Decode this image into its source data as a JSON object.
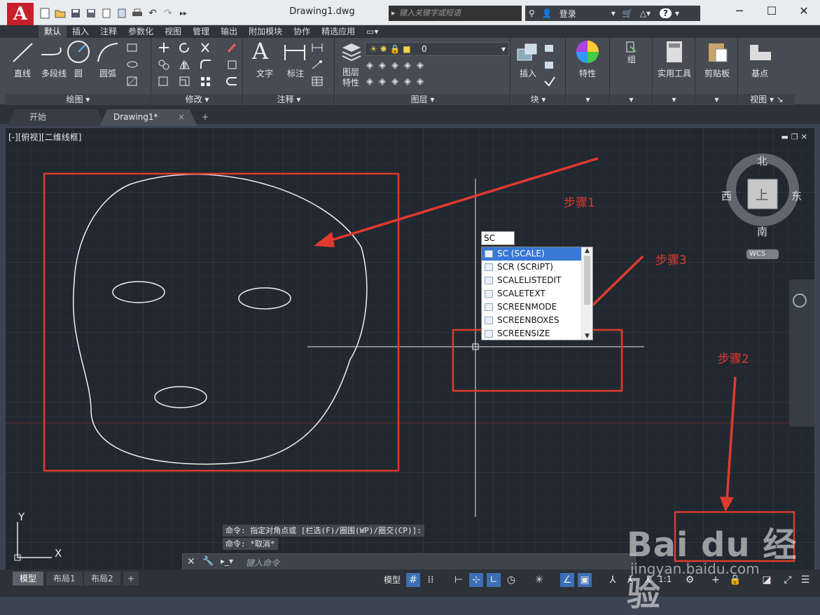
{
  "app": {
    "logo_letter": "A",
    "doc_title": "Drawing1.dwg"
  },
  "search": {
    "placeholder": "键入关键字或短语"
  },
  "user": {
    "login_label": "登录",
    "help_label": "?"
  },
  "ribbon_tabs": [
    "默认",
    "插入",
    "注释",
    "参数化",
    "视图",
    "管理",
    "输出",
    "附加模块",
    "协作",
    "精选应用"
  ],
  "ribbon": {
    "draw": {
      "line": "直线",
      "polyline": "多段线",
      "circle": "圆",
      "arc": "圆弧",
      "panel": "绘图"
    },
    "modify": {
      "panel": "修改"
    },
    "annotation": {
      "text": "文字",
      "dimension": "标注",
      "panel": "注释"
    },
    "layers": {
      "props": "图层\n特性",
      "layer_name": "0",
      "panel": "图层"
    },
    "block": {
      "insert": "插入",
      "panel": "块"
    },
    "properties": {
      "label": "特性"
    },
    "groups": {
      "label": "组"
    },
    "utilities": {
      "label": "实用工具"
    },
    "clipboard": {
      "label": "剪贴板"
    },
    "view": {
      "base": "基点",
      "panel": "视图"
    }
  },
  "doc_tabs": {
    "start": "开始",
    "drawing": "Drawing1*",
    "close": "×",
    "add": "+"
  },
  "viewport": {
    "label": "[-][俯视][二维线框]",
    "viewcube": {
      "north": "北",
      "south": "南",
      "east": "东",
      "west": "西",
      "top": "上",
      "wcs": "WCS"
    },
    "ucs_y": "Y",
    "ucs_x": "X"
  },
  "annotations": {
    "step1": "步骤1",
    "step2": "步骤2",
    "step3": "步骤3"
  },
  "autocomplete": {
    "typed": "SC",
    "items": [
      "SC (SCALE)",
      "SCR (SCRIPT)",
      "SCALELISTEDIT",
      "SCALETEXT",
      "SCREENMODE",
      "SCREENBOXES",
      "SCREENSIZE"
    ],
    "selected_index": 0
  },
  "command_history": [
    "命令: 指定对角点或 [栏选(F)/圈围(WP)/圈交(CP)]:",
    "命令: *取消*"
  ],
  "command_line": {
    "placeholder": "键入命令"
  },
  "status": {
    "layouts": [
      "模型",
      "布局1",
      "布局2"
    ],
    "add_layout": "+",
    "model_label": "模型",
    "scale": "1:1"
  },
  "watermark": {
    "brand": "Bai du 经验",
    "url": "jingyan.baidu.com"
  },
  "colors": {
    "annotation_red": "#e03a2e",
    "canvas": "#212830",
    "ribbon": "#464b54",
    "logo": "#c8202a"
  }
}
